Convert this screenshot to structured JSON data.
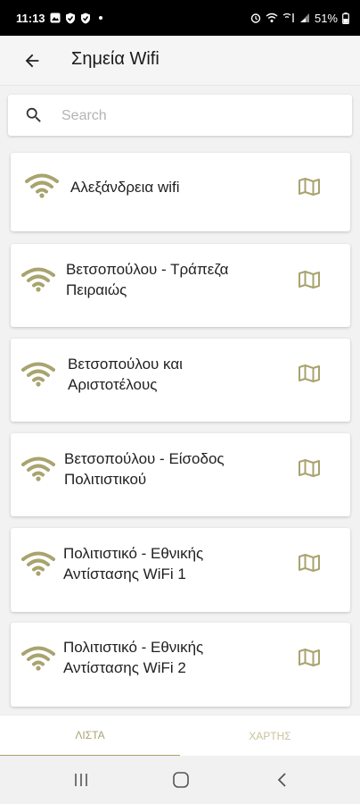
{
  "status_bar": {
    "time": "11:13",
    "battery": "51%"
  },
  "app_bar": {
    "title": "Σημεία Wifi"
  },
  "search": {
    "placeholder": "Search",
    "value": ""
  },
  "colors": {
    "accent": "#a9a36e",
    "wifi_icon": "#a9a36e",
    "map_icon": "#a9a36e"
  },
  "hotspots": [
    {
      "name": "Αλεξάνδρεια wifi",
      "icon": "wifi-icon",
      "action_icon": "map-icon"
    },
    {
      "name": "Βετσοπούλου - Τράπεζα\nΠειραιώς",
      "icon": "wifi-icon",
      "action_icon": "map-icon"
    },
    {
      "name": "Βετσοπούλου και\nΑριστοτέλους",
      "icon": "wifi-icon",
      "action_icon": "map-icon"
    },
    {
      "name": "Βετσοπούλου - Είσοδος\nΠολιτιστικού",
      "icon": "wifi-icon",
      "action_icon": "map-icon"
    },
    {
      "name": "Πολιτιστικό - Εθνικής\nΑντίστασης WiFi 1",
      "icon": "wifi-icon",
      "action_icon": "map-icon"
    },
    {
      "name": "Πολιτιστικό - Εθνικής\nΑντίστασης WiFi 2",
      "icon": "wifi-icon",
      "action_icon": "map-icon"
    }
  ],
  "tabs": [
    {
      "label": "ΛΙΣΤΑ",
      "selected": true
    },
    {
      "label": "ΧΑΡΤΗΣ",
      "selected": false
    }
  ]
}
